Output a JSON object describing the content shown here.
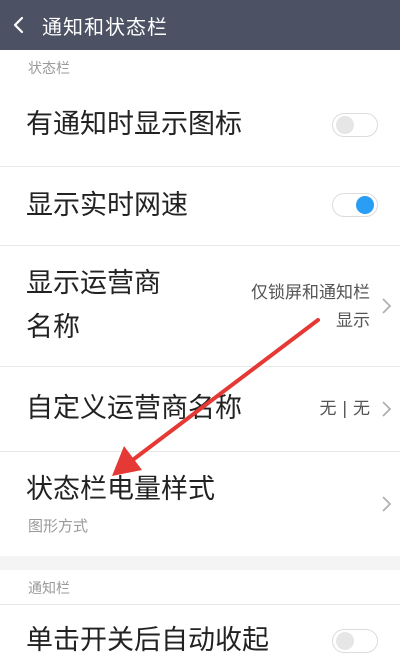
{
  "header": {
    "title": "通知和状态栏"
  },
  "sections": {
    "status_bar": "状态栏",
    "notification_bar": "通知栏"
  },
  "rows": {
    "show_icon": {
      "title": "有通知时显示图标",
      "toggle": false
    },
    "net_speed": {
      "title": "显示实时网速",
      "toggle": true
    },
    "carrier_name": {
      "title_line1": "显示运营商",
      "title_line2": "名称",
      "value_line1": "仅锁屏和通知栏",
      "value_line2": "显示"
    },
    "custom_carrier": {
      "title": "自定义运营商名称",
      "value": "无 | 无"
    },
    "battery_style": {
      "title": "状态栏电量样式",
      "subtitle": "图形方式"
    },
    "auto_collapse": {
      "title": "单击开关后自动收起",
      "toggle": false
    }
  },
  "colors": {
    "header_bg": "#4c5264",
    "accent": "#2a9df4",
    "annotation_arrow": "#e53935"
  },
  "icons": {
    "back": "chevron-left-icon",
    "disclosure": "chevron-right-icon"
  }
}
